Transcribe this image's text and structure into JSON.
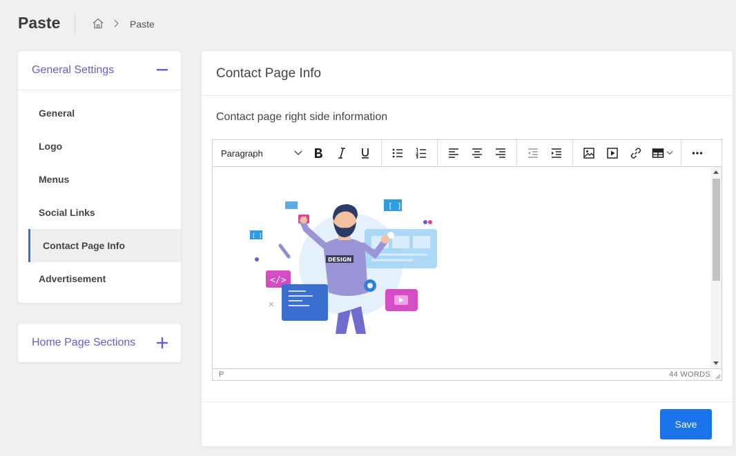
{
  "header": {
    "title": "Paste",
    "breadcrumb": {
      "home_icon": "home-icon",
      "current": "Paste"
    }
  },
  "sidebar": {
    "general_settings": {
      "title": "General Settings",
      "toggle_icon": "minus-icon",
      "items": [
        {
          "label": "General",
          "active": false
        },
        {
          "label": "Logo",
          "active": false
        },
        {
          "label": "Menus",
          "active": false
        },
        {
          "label": "Social Links",
          "active": false
        },
        {
          "label": "Contact Page Info",
          "active": true
        },
        {
          "label": "Advertisement",
          "active": false
        }
      ]
    },
    "home_page_sections": {
      "title": "Home Page Sections",
      "toggle_icon": "plus-icon"
    }
  },
  "main": {
    "title": "Contact Page Info",
    "field_label": "Contact page right side information",
    "editor": {
      "block_format": "Paragraph",
      "status_path": "P",
      "word_count": "44 WORDS",
      "image_text": "DESIGN"
    },
    "save_label": "Save"
  },
  "colors": {
    "accent": "#6a5acd",
    "primary_button": "#1a73e8",
    "active_border": "#3d6ed8"
  }
}
